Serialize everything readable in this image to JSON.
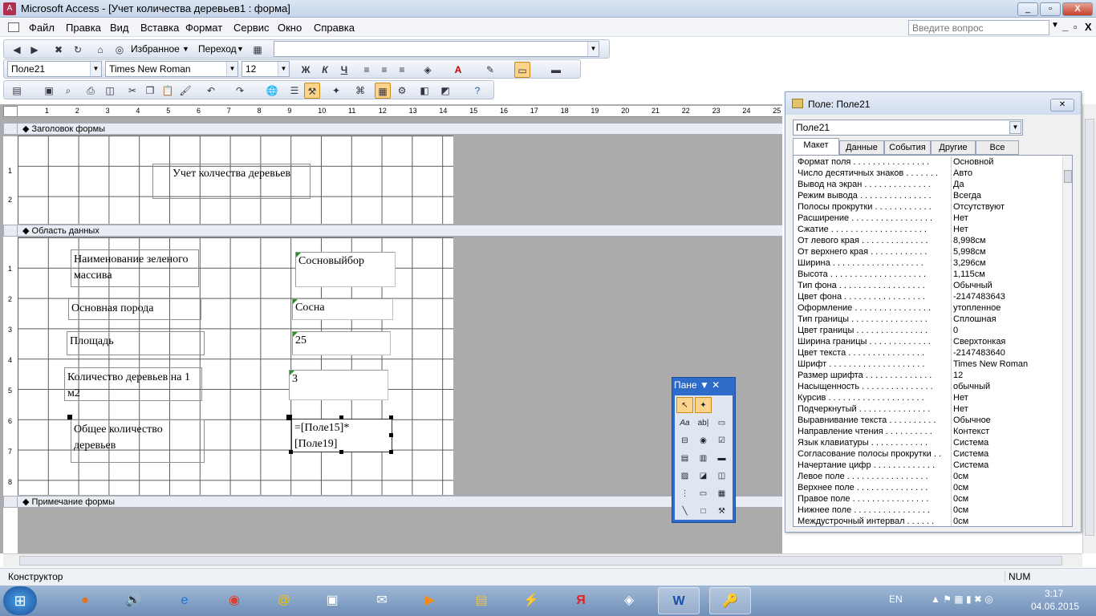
{
  "window": {
    "title": "Microsoft Access - [Учет количества деревьев1 : форма]",
    "min": "_",
    "restore": "▫",
    "close": "X"
  },
  "menu": {
    "items": [
      "Файл",
      "Правка",
      "Вид",
      "Вставка",
      "Формат",
      "Сервис",
      "Окно",
      "Справка"
    ],
    "ask_placeholder": "Введите вопрос",
    "mdi_min": "_",
    "mdi_restore": "▫",
    "mdi_close": "X"
  },
  "toolbar1": {
    "favorites": "Избранное",
    "go": "Переход"
  },
  "toolbar2": {
    "object_combo": "Поле21",
    "font_combo": "Times New Roman",
    "size_combo": "12",
    "bold": "Ж",
    "italic": "К",
    "underline": "Ч"
  },
  "form": {
    "header_section": "Заголовок формы",
    "detail_section": "Область данных",
    "footer_section": "Примечание формы",
    "title_label": "Учет колчества деревьев",
    "labels": {
      "forest_name": "Наименование зеленого массива",
      "main_species": "Основная порода",
      "area": "Площадь",
      "tree_count": "Количество деревьев на 1 м2",
      "total_trees": "Общее количество деревьев"
    },
    "fields": {
      "forest_name": "Сосновыйбор",
      "main_species": "Сосна",
      "area": "25",
      "tree_count": "3",
      "total_trees": "=[Поле15]*[Поле19]"
    }
  },
  "ruler": {
    "h": [
      "1",
      "2",
      "3",
      "4",
      "5",
      "6",
      "7",
      "8",
      "9",
      "10",
      "11",
      "12",
      "13",
      "14",
      "15",
      "16",
      "17",
      "18",
      "19",
      "20",
      "21",
      "22",
      "23",
      "24",
      "25"
    ],
    "v": [
      "1",
      "2",
      "1",
      "2",
      "3",
      "4",
      "5",
      "6",
      "7",
      "8"
    ]
  },
  "toolbox": {
    "title": "Пане"
  },
  "props": {
    "title": "Поле: Поле21",
    "close": "✕",
    "selected": "Поле21",
    "tabs": [
      "Макет",
      "Данные",
      "События",
      "Другие",
      "Все"
    ],
    "active_tab": "Макет",
    "rows": [
      [
        "Формат поля . . . . . . . . . . . . . . . .",
        "Основной"
      ],
      [
        "Число десятичных знаков . . . . . . .",
        "Авто"
      ],
      [
        "Вывод на экран . . . . . . . . . . . . . .",
        "Да"
      ],
      [
        "Режим вывода . . . . . . . . . . . . . . .",
        "Всегда"
      ],
      [
        "Полосы прокрутки . . . . . . . . . . . .",
        "Отсутствуют"
      ],
      [
        "Расширение . . . . . . . . . . . . . . . . .",
        "Нет"
      ],
      [
        "Сжатие . . . . . . . . . . . . . . . . . . . .",
        "Нет"
      ],
      [
        "От левого края . . . . . . . . . . . . . .",
        "8,998см"
      ],
      [
        "От верхнего края . . . . . . . . . . . .",
        "5,998см"
      ],
      [
        "Ширина . . . . . . . . . . . . . . . . . . .",
        "3,296см"
      ],
      [
        "Высота . . . . . . . . . . . . . . . . . . . .",
        "1,115см"
      ],
      [
        "Тип фона . . . . . . . . . . . . . . . . . .",
        "Обычный"
      ],
      [
        "Цвет фона . . . . . . . . . . . . . . . . .",
        "-2147483643"
      ],
      [
        "Оформление . . . . . . . . . . . . . . . .",
        "утопленное"
      ],
      [
        "Тип границы . . . . . . . . . . . . . . . .",
        "Сплошная"
      ],
      [
        "Цвет границы . . . . . . . . . . . . . . .",
        "0"
      ],
      [
        "Ширина границы . . . . . . . . . . . . .",
        "Сверхтонкая"
      ],
      [
        "Цвет текста . . . . . . . . . . . . . . . .",
        "-2147483640"
      ],
      [
        "Шрифт . . . . . . . . . . . . . . . . . . . .",
        "Times New Roman"
      ],
      [
        "Размер шрифта . . . . . . . . . . . . . .",
        "12"
      ],
      [
        "Насыщенность . . . . . . . . . . . . . . .",
        "обычный"
      ],
      [
        "Курсив . . . . . . . . . . . . . . . . . . . .",
        "Нет"
      ],
      [
        "Подчеркнутый . . . . . . . . . . . . . . .",
        "Нет"
      ],
      [
        "Выравнивание текста . . . . . . . . . .",
        "Обычное"
      ],
      [
        "Направление чтения . . . . . . . . . .",
        "Контекст"
      ],
      [
        "Язык клавиатуры . . . . . . . . . . . .",
        "Система"
      ],
      [
        "Согласование полосы прокрутки . .",
        "Система"
      ],
      [
        "Начертание цифр . . . . . . . . . . . . .",
        "Система"
      ],
      [
        "Левое поле . . . . . . . . . . . . . . . . .",
        "0см"
      ],
      [
        "Верхнее поле . . . . . . . . . . . . . . .",
        "0см"
      ],
      [
        "Правое поле . . . . . . . . . . . . . . . .",
        "0см"
      ],
      [
        "Нижнее поле . . . . . . . . . . . . . . . .",
        "0см"
      ],
      [
        "Междустрочный интервал . . . . . .",
        "0см"
      ]
    ]
  },
  "status": {
    "mode": "Конструктор",
    "num": "NUM"
  },
  "taskbar": {
    "lang": "EN",
    "time": "3:17",
    "date": "04.06.2015"
  }
}
